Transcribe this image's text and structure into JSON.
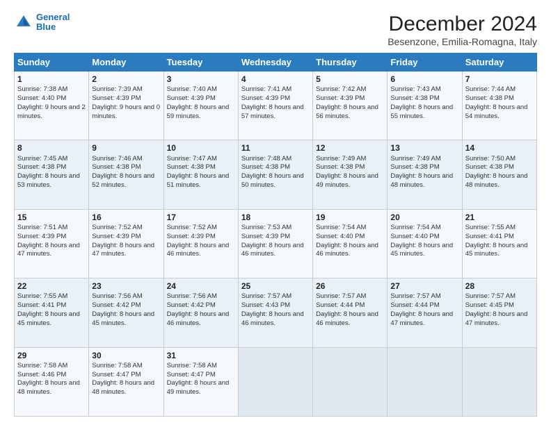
{
  "logo": {
    "line1": "General",
    "line2": "Blue"
  },
  "title": "December 2024",
  "subtitle": "Besenzone, Emilia-Romagna, Italy",
  "header_days": [
    "Sunday",
    "Monday",
    "Tuesday",
    "Wednesday",
    "Thursday",
    "Friday",
    "Saturday"
  ],
  "weeks": [
    [
      {
        "day": "1",
        "sunrise": "Sunrise: 7:38 AM",
        "sunset": "Sunset: 4:40 PM",
        "daylight": "Daylight: 9 hours and 2 minutes."
      },
      {
        "day": "2",
        "sunrise": "Sunrise: 7:39 AM",
        "sunset": "Sunset: 4:39 PM",
        "daylight": "Daylight: 9 hours and 0 minutes."
      },
      {
        "day": "3",
        "sunrise": "Sunrise: 7:40 AM",
        "sunset": "Sunset: 4:39 PM",
        "daylight": "Daylight: 8 hours and 59 minutes."
      },
      {
        "day": "4",
        "sunrise": "Sunrise: 7:41 AM",
        "sunset": "Sunset: 4:39 PM",
        "daylight": "Daylight: 8 hours and 57 minutes."
      },
      {
        "day": "5",
        "sunrise": "Sunrise: 7:42 AM",
        "sunset": "Sunset: 4:39 PM",
        "daylight": "Daylight: 8 hours and 56 minutes."
      },
      {
        "day": "6",
        "sunrise": "Sunrise: 7:43 AM",
        "sunset": "Sunset: 4:38 PM",
        "daylight": "Daylight: 8 hours and 55 minutes."
      },
      {
        "day": "7",
        "sunrise": "Sunrise: 7:44 AM",
        "sunset": "Sunset: 4:38 PM",
        "daylight": "Daylight: 8 hours and 54 minutes."
      }
    ],
    [
      {
        "day": "8",
        "sunrise": "Sunrise: 7:45 AM",
        "sunset": "Sunset: 4:38 PM",
        "daylight": "Daylight: 8 hours and 53 minutes."
      },
      {
        "day": "9",
        "sunrise": "Sunrise: 7:46 AM",
        "sunset": "Sunset: 4:38 PM",
        "daylight": "Daylight: 8 hours and 52 minutes."
      },
      {
        "day": "10",
        "sunrise": "Sunrise: 7:47 AM",
        "sunset": "Sunset: 4:38 PM",
        "daylight": "Daylight: 8 hours and 51 minutes."
      },
      {
        "day": "11",
        "sunrise": "Sunrise: 7:48 AM",
        "sunset": "Sunset: 4:38 PM",
        "daylight": "Daylight: 8 hours and 50 minutes."
      },
      {
        "day": "12",
        "sunrise": "Sunrise: 7:49 AM",
        "sunset": "Sunset: 4:38 PM",
        "daylight": "Daylight: 8 hours and 49 minutes."
      },
      {
        "day": "13",
        "sunrise": "Sunrise: 7:49 AM",
        "sunset": "Sunset: 4:38 PM",
        "daylight": "Daylight: 8 hours and 48 minutes."
      },
      {
        "day": "14",
        "sunrise": "Sunrise: 7:50 AM",
        "sunset": "Sunset: 4:38 PM",
        "daylight": "Daylight: 8 hours and 48 minutes."
      }
    ],
    [
      {
        "day": "15",
        "sunrise": "Sunrise: 7:51 AM",
        "sunset": "Sunset: 4:39 PM",
        "daylight": "Daylight: 8 hours and 47 minutes."
      },
      {
        "day": "16",
        "sunrise": "Sunrise: 7:52 AM",
        "sunset": "Sunset: 4:39 PM",
        "daylight": "Daylight: 8 hours and 47 minutes."
      },
      {
        "day": "17",
        "sunrise": "Sunrise: 7:52 AM",
        "sunset": "Sunset: 4:39 PM",
        "daylight": "Daylight: 8 hours and 46 minutes."
      },
      {
        "day": "18",
        "sunrise": "Sunrise: 7:53 AM",
        "sunset": "Sunset: 4:39 PM",
        "daylight": "Daylight: 8 hours and 46 minutes."
      },
      {
        "day": "19",
        "sunrise": "Sunrise: 7:54 AM",
        "sunset": "Sunset: 4:40 PM",
        "daylight": "Daylight: 8 hours and 46 minutes."
      },
      {
        "day": "20",
        "sunrise": "Sunrise: 7:54 AM",
        "sunset": "Sunset: 4:40 PM",
        "daylight": "Daylight: 8 hours and 45 minutes."
      },
      {
        "day": "21",
        "sunrise": "Sunrise: 7:55 AM",
        "sunset": "Sunset: 4:41 PM",
        "daylight": "Daylight: 8 hours and 45 minutes."
      }
    ],
    [
      {
        "day": "22",
        "sunrise": "Sunrise: 7:55 AM",
        "sunset": "Sunset: 4:41 PM",
        "daylight": "Daylight: 8 hours and 45 minutes."
      },
      {
        "day": "23",
        "sunrise": "Sunrise: 7:56 AM",
        "sunset": "Sunset: 4:42 PM",
        "daylight": "Daylight: 8 hours and 45 minutes."
      },
      {
        "day": "24",
        "sunrise": "Sunrise: 7:56 AM",
        "sunset": "Sunset: 4:42 PM",
        "daylight": "Daylight: 8 hours and 46 minutes."
      },
      {
        "day": "25",
        "sunrise": "Sunrise: 7:57 AM",
        "sunset": "Sunset: 4:43 PM",
        "daylight": "Daylight: 8 hours and 46 minutes."
      },
      {
        "day": "26",
        "sunrise": "Sunrise: 7:57 AM",
        "sunset": "Sunset: 4:44 PM",
        "daylight": "Daylight: 8 hours and 46 minutes."
      },
      {
        "day": "27",
        "sunrise": "Sunrise: 7:57 AM",
        "sunset": "Sunset: 4:44 PM",
        "daylight": "Daylight: 8 hours and 47 minutes."
      },
      {
        "day": "28",
        "sunrise": "Sunrise: 7:57 AM",
        "sunset": "Sunset: 4:45 PM",
        "daylight": "Daylight: 8 hours and 47 minutes."
      }
    ],
    [
      {
        "day": "29",
        "sunrise": "Sunrise: 7:58 AM",
        "sunset": "Sunset: 4:46 PM",
        "daylight": "Daylight: 8 hours and 48 minutes."
      },
      {
        "day": "30",
        "sunrise": "Sunrise: 7:58 AM",
        "sunset": "Sunset: 4:47 PM",
        "daylight": "Daylight: 8 hours and 48 minutes."
      },
      {
        "day": "31",
        "sunrise": "Sunrise: 7:58 AM",
        "sunset": "Sunset: 4:47 PM",
        "daylight": "Daylight: 8 hours and 49 minutes."
      },
      null,
      null,
      null,
      null
    ]
  ]
}
